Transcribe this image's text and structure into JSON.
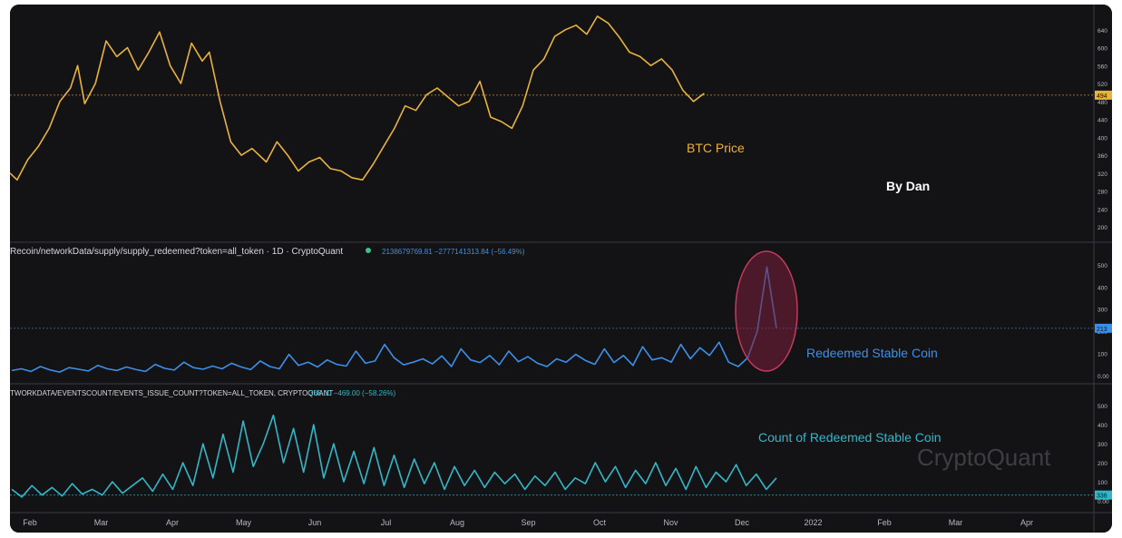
{
  "colors": {
    "background": "#131316",
    "btc": "#e8b23c",
    "redeemed": "#3d8fe6",
    "count": "#30b8c8",
    "axis_text": "#b8b8c0",
    "highlight_fill": "#7a1f3d",
    "highlight_stroke": "#c23a5c"
  },
  "annotations": {
    "btc_label": "BTC Price",
    "author": "By Dan",
    "redeemed_label": "Redeemed Stable Coin",
    "count_label": "Count of Redeemed Stable Coin",
    "watermark": "CryptoQuant"
  },
  "chart_data": [
    {
      "type": "line",
      "name": "btc-price",
      "x_ticks": [
        "Feb",
        "Mar",
        "Apr",
        "May",
        "Jun",
        "Jul",
        "Aug",
        "Sep",
        "Oct",
        "Nov",
        "Dec",
        "2022",
        "Feb",
        "Mar",
        "Apr"
      ],
      "y_ticks": [
        "200",
        "240",
        "280",
        "320",
        "360",
        "400",
        "440",
        "480",
        "520",
        "560",
        "600",
        "640"
      ],
      "last_value_label": "494",
      "reference_line": 494,
      "ylim": [
        180,
        680
      ],
      "series": [
        {
          "x": [
            0,
            0.1,
            0.25,
            0.4,
            0.55,
            0.7,
            0.85,
            0.95,
            1.05,
            1.2,
            1.35,
            1.5,
            1.65,
            1.8,
            1.95,
            2.1,
            2.25,
            2.4,
            2.55,
            2.7,
            2.8,
            2.95,
            3.1,
            3.25,
            3.4,
            3.6,
            3.75,
            3.9,
            4.05,
            4.2,
            4.35,
            4.5,
            4.65,
            4.8,
            4.95,
            5.1,
            5.25,
            5.4,
            5.55,
            5.7,
            5.85,
            6.0,
            6.15,
            6.3,
            6.45,
            6.6,
            6.75,
            6.9,
            7.05,
            7.2,
            7.35,
            7.5,
            7.65,
            7.8,
            7.95,
            8.1,
            8.25,
            8.4,
            8.55,
            8.7,
            8.85,
            9.0,
            9.15,
            9.3,
            9.45,
            9.6,
            9.75,
            9.9,
            10.05,
            10.2,
            10.35
          ],
          "values": [
            320,
            305,
            350,
            380,
            420,
            480,
            510,
            560,
            475,
            520,
            615,
            580,
            600,
            550,
            590,
            635,
            560,
            520,
            610,
            570,
            590,
            480,
            390,
            360,
            375,
            345,
            390,
            360,
            325,
            345,
            355,
            330,
            325,
            310,
            305,
            340,
            380,
            420,
            470,
            460,
            495,
            510,
            490,
            470,
            480,
            525,
            445,
            435,
            420,
            470,
            550,
            575,
            625,
            640,
            650,
            630,
            670,
            655,
            625,
            590,
            580,
            560,
            575,
            550,
            505,
            480,
            498,
            0,
            0,
            0,
            0
          ],
          "count": 67
        }
      ]
    },
    {
      "type": "line",
      "name": "supply-redeemed",
      "title": "Recoin/networkData/supply/supply_redeemed?token=all_token · 1D · CryptoQuant",
      "legend_values": "2138679769.81 −2777141313.84 (−56.49%)",
      "y_ticks": [
        "0.00",
        "100",
        "200",
        "300",
        "400",
        "500"
      ],
      "last_value_label": "213",
      "reference_line": 213,
      "ylim": [
        -5,
        520
      ],
      "series": [
        {
          "values": [
            22,
            30,
            18,
            40,
            25,
            15,
            35,
            28,
            20,
            45,
            30,
            22,
            38,
            26,
            18,
            50,
            32,
            24,
            60,
            35,
            28,
            42,
            30,
            55,
            38,
            26,
            65,
            40,
            30,
            95,
            45,
            60,
            38,
            70,
            50,
            42,
            110,
            55,
            65,
            140,
            80,
            48,
            60,
            75,
            52,
            88,
            40,
            120,
            70,
            58,
            90,
            48,
            110,
            62,
            85,
            55,
            40,
            75,
            60,
            95,
            68,
            50,
            120,
            58,
            90,
            45,
            130,
            70,
            80,
            60,
            140,
            75,
            125,
            90,
            150,
            60,
            40,
            80,
            200,
            490,
            215
          ]
        }
      ]
    },
    {
      "type": "line",
      "name": "events-issue-count",
      "title": "TWORKDATA/EVENTSCOUNT/EVENTS_ISSUE_COUNT?TOKEN=ALL_TOKEN, CRYPTOQUANT",
      "legend_values": "336.00 −469.00 (−58.26%)",
      "y_ticks": [
        "0.00",
        "100",
        "200",
        "300",
        "400",
        "500"
      ],
      "last_value_label": "336",
      "reference_line": 30,
      "ylim": [
        -5,
        520
      ],
      "series": [
        {
          "values": [
            60,
            20,
            80,
            30,
            70,
            25,
            90,
            35,
            60,
            30,
            100,
            40,
            80,
            120,
            50,
            140,
            60,
            200,
            80,
            300,
            120,
            350,
            150,
            420,
            180,
            300,
            450,
            200,
            380,
            150,
            400,
            120,
            300,
            100,
            260,
            90,
            280,
            80,
            240,
            70,
            220,
            90,
            200,
            60,
            180,
            80,
            160,
            70,
            150,
            90,
            140,
            60,
            130,
            80,
            150,
            60,
            120,
            90,
            200,
            100,
            180,
            70,
            160,
            90,
            200,
            80,
            170,
            60,
            180,
            70,
            150,
            100,
            190,
            80,
            140,
            60,
            120
          ]
        }
      ]
    }
  ]
}
